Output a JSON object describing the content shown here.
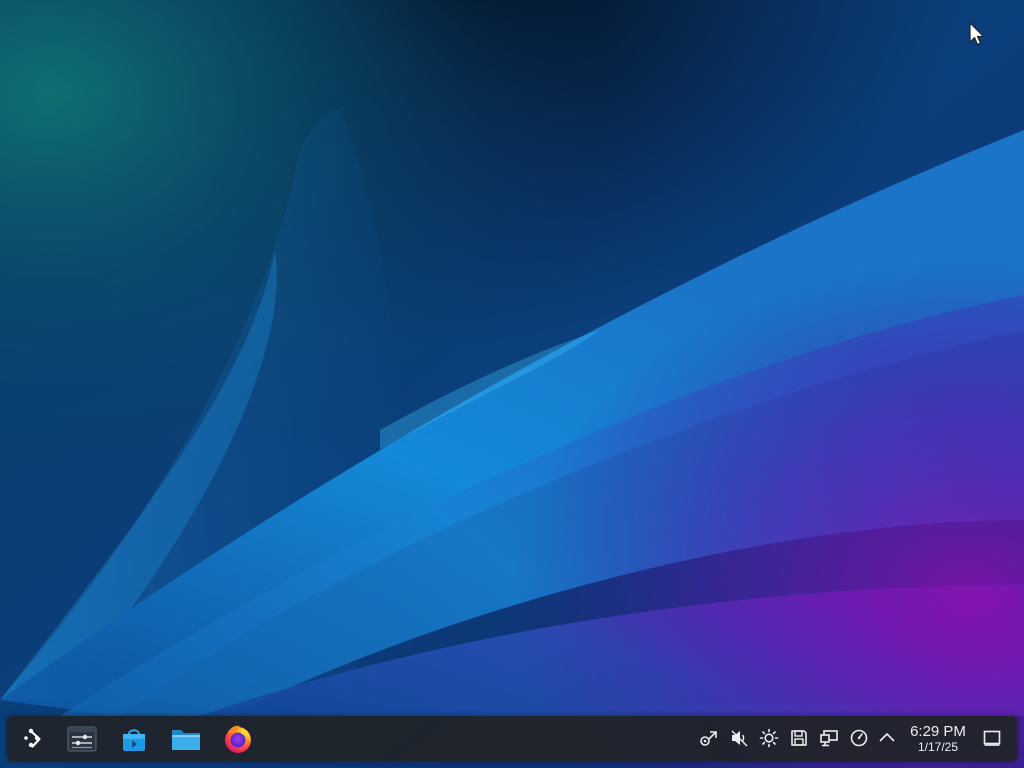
{
  "desktop": {
    "wallpaper_colors": {
      "base": "#0b3d72",
      "teal_glow": "#0f6f73",
      "blue_highlight": "#1ba4f0",
      "magenta_glow": "#8a0fb0",
      "dark": "#041a3a"
    }
  },
  "taskbar": {
    "launchers": [
      {
        "name": "application-launcher",
        "icon": "kde-launcher-icon"
      },
      {
        "name": "system-settings",
        "icon": "settings-sliders-icon"
      },
      {
        "name": "discover-store",
        "icon": "store-bag-icon"
      },
      {
        "name": "dolphin-file-manager",
        "icon": "folder-icon"
      },
      {
        "name": "firefox",
        "icon": "firefox-icon"
      }
    ],
    "tray": {
      "icons": [
        "kde-connect-icon",
        "volume-muted-icon",
        "brightness-icon",
        "disks-icon",
        "network-icon",
        "power-profile-icon",
        "expand-tray-icon"
      ]
    },
    "clock": {
      "time": "6:29 PM",
      "date": "1/17/25"
    },
    "show_desktop_icon": "show-desktop-icon"
  }
}
